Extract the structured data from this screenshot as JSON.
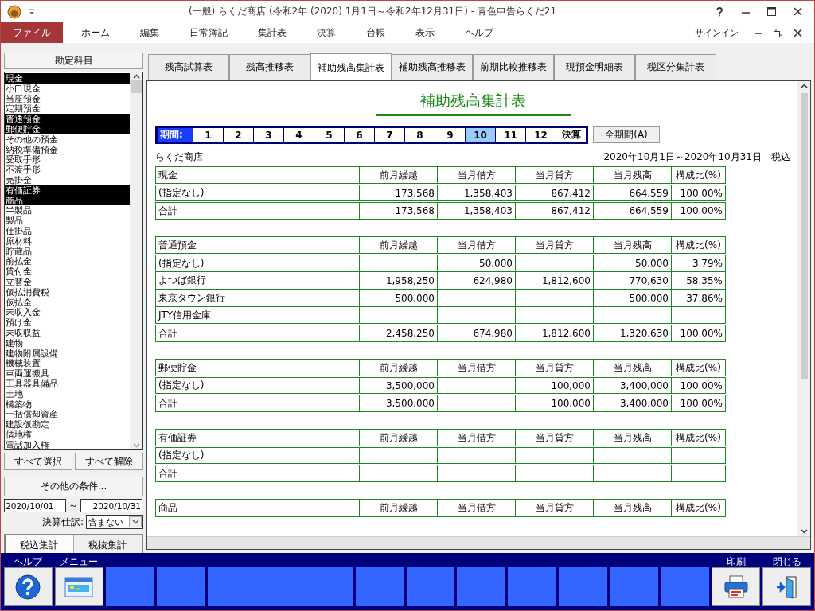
{
  "window": {
    "title": "(一般) らくだ商店 (令和2年 (2020) 1月1日～令和2年12月31日) - 青色申告らくだ21"
  },
  "menu": [
    {
      "label": "ファイル",
      "selected": true
    },
    {
      "label": "ホーム",
      "selected": false
    },
    {
      "label": "編集",
      "selected": false
    },
    {
      "label": "日常簿記",
      "selected": false
    },
    {
      "label": "集計表",
      "selected": false
    },
    {
      "label": "決算",
      "selected": false
    },
    {
      "label": "台帳",
      "selected": false
    },
    {
      "label": "表示",
      "selected": false
    },
    {
      "label": "ヘルプ",
      "selected": false
    }
  ],
  "account": "サインイン",
  "sidebar": {
    "header": "勘定科目",
    "accounts": [
      {
        "label": "現金",
        "selected": true
      },
      {
        "label": "小口現金",
        "selected": false
      },
      {
        "label": "当座預金",
        "selected": false
      },
      {
        "label": "定期預金",
        "selected": false
      },
      {
        "label": "普通預金",
        "selected": true
      },
      {
        "label": "郵便貯金",
        "selected": true
      },
      {
        "label": "その他の預金",
        "selected": false
      },
      {
        "label": "納税準備預金",
        "selected": false
      },
      {
        "label": "受取手形",
        "selected": false
      },
      {
        "label": "不渡手形",
        "selected": false
      },
      {
        "label": "売掛金",
        "selected": false
      },
      {
        "label": "有価証券",
        "selected": true
      },
      {
        "label": "商品",
        "selected": true
      },
      {
        "label": "半製品",
        "selected": false
      },
      {
        "label": "製品",
        "selected": false
      },
      {
        "label": "仕掛品",
        "selected": false
      },
      {
        "label": "原材料",
        "selected": false
      },
      {
        "label": "貯蔵品",
        "selected": false
      },
      {
        "label": "前払金",
        "selected": false
      },
      {
        "label": "貸付金",
        "selected": false
      },
      {
        "label": "立替金",
        "selected": false
      },
      {
        "label": "仮払消費税",
        "selected": false
      },
      {
        "label": "仮払金",
        "selected": false
      },
      {
        "label": "未収入金",
        "selected": false
      },
      {
        "label": "預け金",
        "selected": false
      },
      {
        "label": "未収収益",
        "selected": false
      },
      {
        "label": "建物",
        "selected": false
      },
      {
        "label": "建物附属設備",
        "selected": false
      },
      {
        "label": "機械装置",
        "selected": false
      },
      {
        "label": "車両運搬具",
        "selected": false
      },
      {
        "label": "工具器具備品",
        "selected": false
      },
      {
        "label": "土地",
        "selected": false
      },
      {
        "label": "構築物",
        "selected": false
      },
      {
        "label": "一括償却資産",
        "selected": false
      },
      {
        "label": "建設仮勘定",
        "selected": false
      },
      {
        "label": "借地権",
        "selected": false
      },
      {
        "label": "電話加入権",
        "selected": false
      }
    ],
    "select_all": "すべて選択",
    "clear_all": "すべて解除",
    "conditions": "その他の条件...",
    "date_from": "2020/10/01",
    "date_sep": "～",
    "date_to": "2020/10/31",
    "closing_label": "決算仕訳:",
    "closing_value": "含まない",
    "tax_tabs": [
      {
        "label": "税込集計",
        "selected": true
      },
      {
        "label": "税抜集計",
        "selected": false
      }
    ]
  },
  "report_tabs": [
    {
      "label": "残高試算表",
      "selected": false
    },
    {
      "label": "残高推移表",
      "selected": false
    },
    {
      "label": "補助残高集計表",
      "selected": true
    },
    {
      "label": "補助残高推移表",
      "selected": false
    },
    {
      "label": "前期比較推移表",
      "selected": false
    },
    {
      "label": "現預金明細表",
      "selected": false
    },
    {
      "label": "税区分集計表",
      "selected": false
    }
  ],
  "report": {
    "title": "補助残高集計表",
    "period_label": "期間:",
    "periods": [
      {
        "label": "1",
        "selected": false
      },
      {
        "label": "2",
        "selected": false
      },
      {
        "label": "3",
        "selected": false
      },
      {
        "label": "4",
        "selected": false
      },
      {
        "label": "5",
        "selected": false
      },
      {
        "label": "6",
        "selected": false
      },
      {
        "label": "7",
        "selected": false
      },
      {
        "label": "8",
        "selected": false
      },
      {
        "label": "9",
        "selected": false
      },
      {
        "label": "10",
        "selected": true
      },
      {
        "label": "11",
        "selected": false
      },
      {
        "label": "12",
        "selected": false
      },
      {
        "label": "決算",
        "selected": false
      }
    ],
    "all_periods": "全期間(A)",
    "company": "らくだ商店",
    "range": "2020年10月1日～2020年10月31日",
    "tax": "税込",
    "sections": [
      {
        "header": [
          "現金",
          "前月繰越",
          "当月借方",
          "当月貸方",
          "当月残高",
          "構成比(%)"
        ],
        "rows": [
          {
            "kind": "item",
            "cells": [
              "(指定なし)",
              "173,568",
              "1,358,403",
              "867,412",
              "664,559",
              "100.00%"
            ]
          },
          {
            "kind": "total",
            "cells": [
              "合計",
              "173,568",
              "1,358,403",
              "867,412",
              "664,559",
              "100.00%"
            ]
          }
        ]
      },
      {
        "header": [
          "普通預金",
          "前月繰越",
          "当月借方",
          "当月貸方",
          "当月残高",
          "構成比(%)"
        ],
        "rows": [
          {
            "kind": "item",
            "cells": [
              "(指定なし)",
              null,
              "50,000",
              null,
              "50,000",
              "3.79%"
            ]
          },
          {
            "kind": "item",
            "cells": [
              "よつば銀行",
              "1,958,250",
              "624,980",
              "1,812,600",
              "770,630",
              "58.35%"
            ]
          },
          {
            "kind": "item",
            "cells": [
              "東京タウン銀行",
              "500,000",
              null,
              null,
              "500,000",
              "37.86%"
            ]
          },
          {
            "kind": "item",
            "cells": [
              "JTY信用金庫",
              null,
              null,
              null,
              null,
              null
            ]
          },
          {
            "kind": "total",
            "cells": [
              "合計",
              "2,458,250",
              "674,980",
              "1,812,600",
              "1,320,630",
              "100.00%"
            ]
          }
        ]
      },
      {
        "header": [
          "郵便貯金",
          "前月繰越",
          "当月借方",
          "当月貸方",
          "当月残高",
          "構成比(%)"
        ],
        "rows": [
          {
            "kind": "item",
            "cells": [
              "(指定なし)",
              "3,500,000",
              null,
              "100,000",
              "3,400,000",
              "100.00%"
            ]
          },
          {
            "kind": "total",
            "cells": [
              "合計",
              "3,500,000",
              null,
              "100,000",
              "3,400,000",
              "100.00%"
            ]
          }
        ]
      },
      {
        "header": [
          "有価証券",
          "前月繰越",
          "当月借方",
          "当月貸方",
          "当月残高",
          "構成比(%)"
        ],
        "rows": [
          {
            "kind": "item",
            "cells": [
              "(指定なし)",
              null,
              null,
              null,
              null,
              null
            ]
          },
          {
            "kind": "total",
            "cells": [
              "合計",
              null,
              null,
              null,
              null,
              null
            ]
          }
        ]
      },
      {
        "header": [
          "商品",
          "前月繰越",
          "当月借方",
          "当月貸方",
          "当月残高",
          "構成比(%)"
        ]
      }
    ]
  },
  "function_keys": [
    {
      "kind": "help",
      "label": "ヘルプ"
    },
    {
      "kind": "menu",
      "label": "メニュー"
    },
    {
      "kind": "blank"
    },
    {
      "kind": "blank"
    },
    {
      "kind": "blank",
      "wide": true
    },
    {
      "kind": "blank"
    },
    {
      "kind": "blank"
    },
    {
      "kind": "blank"
    },
    {
      "kind": "blank"
    },
    {
      "kind": "blank"
    },
    {
      "kind": "blank"
    },
    {
      "kind": "blank"
    },
    {
      "kind": "print",
      "label": "印刷"
    },
    {
      "kind": "close",
      "label": "閉じる"
    }
  ]
}
